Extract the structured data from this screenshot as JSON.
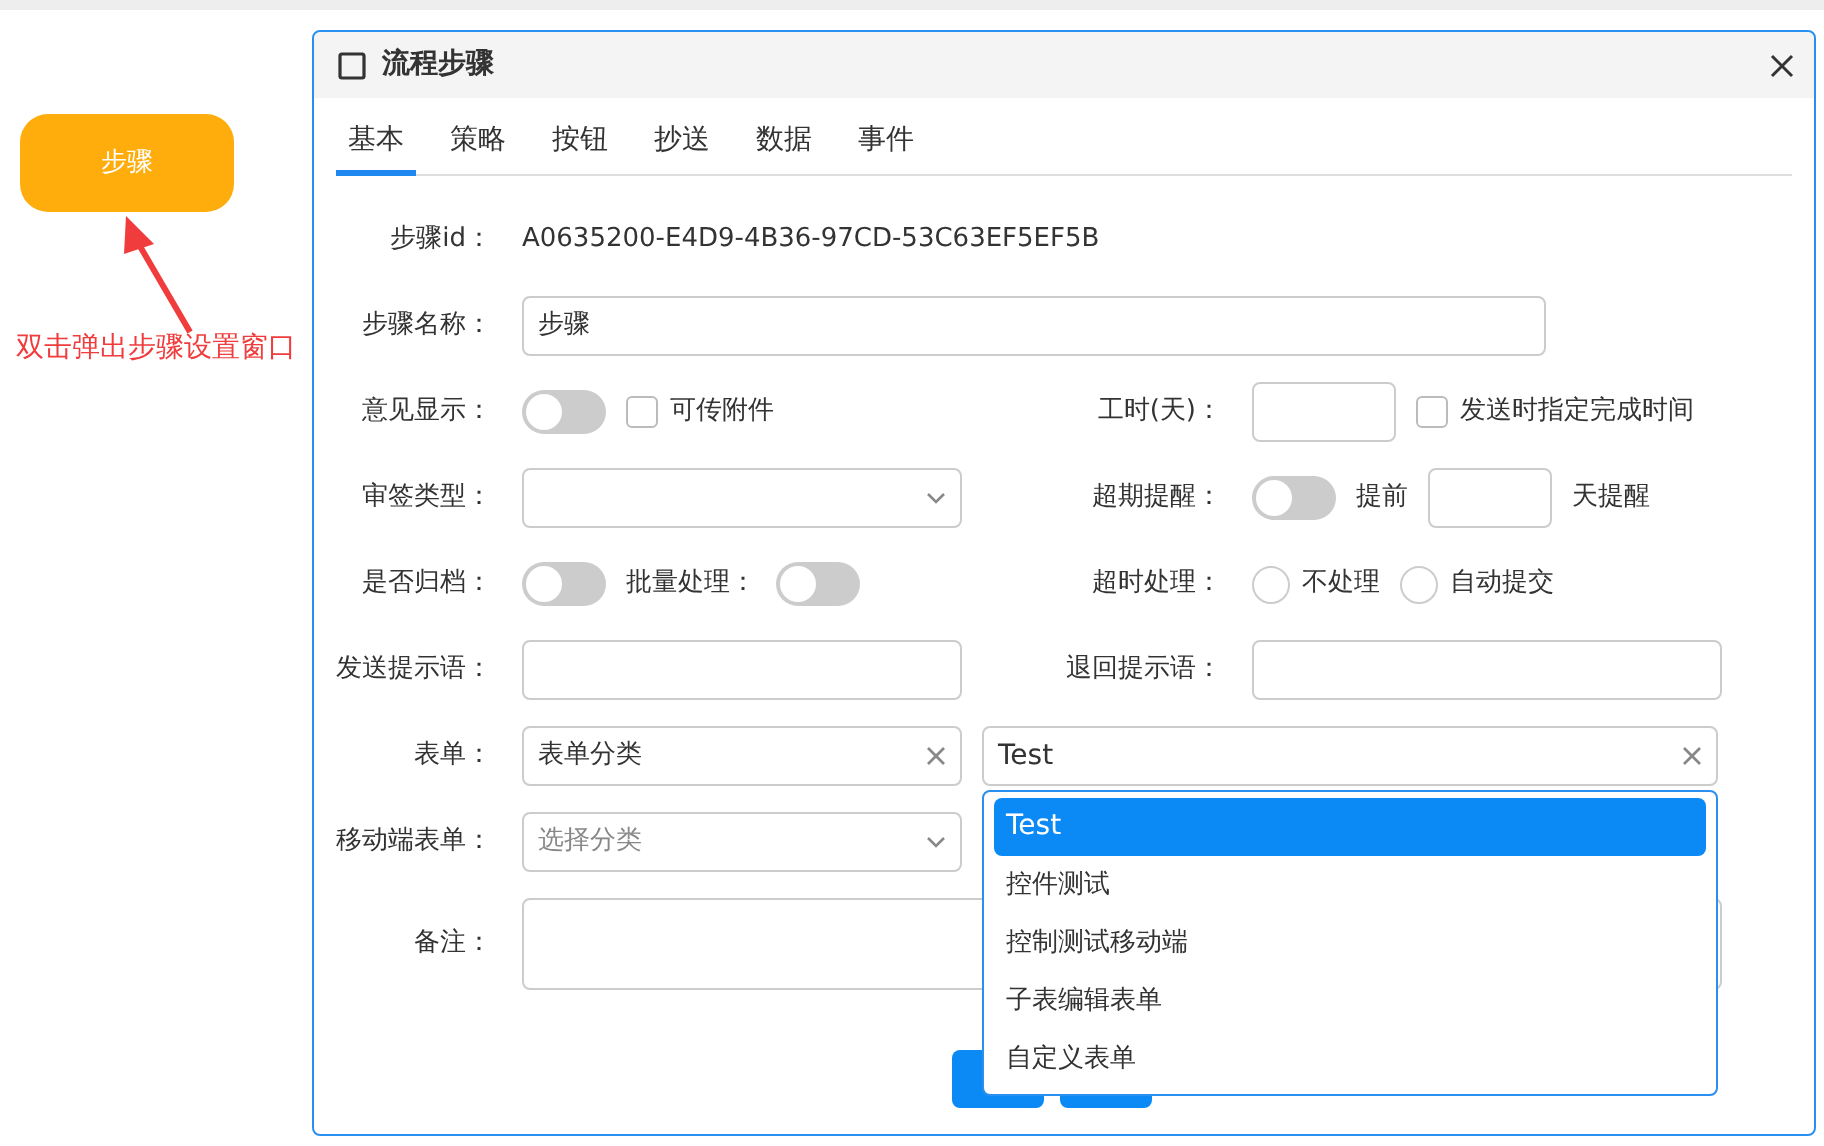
{
  "canvas": {
    "node": {
      "label": "步骤"
    },
    "annotation": "双击弹出步骤设置窗口"
  },
  "dialog": {
    "title": "流程步骤",
    "tabs": [
      {
        "label": "基本",
        "selected": true
      },
      {
        "label": "策略",
        "selected": false
      },
      {
        "label": "按钮",
        "selected": false
      },
      {
        "label": "抄送",
        "selected": false
      },
      {
        "label": "数据",
        "selected": false
      },
      {
        "label": "事件",
        "selected": false
      }
    ],
    "rows": [
      {
        "left": [
          {
            "kind": "label",
            "text": "步骤id："
          },
          {
            "kind": "text",
            "text": "A0635200-E4D9-4B36-97CD-53C63EF5EF5B"
          }
        ]
      },
      {
        "left": [
          {
            "kind": "label",
            "text": "步骤名称："
          },
          {
            "kind": "wideinput",
            "value": "步骤"
          }
        ]
      },
      {
        "left": [
          {
            "kind": "label",
            "text": "意见显示："
          },
          {
            "kind": "toggle",
            "on": false
          },
          {
            "kind": "checkbox",
            "text": "可传附件",
            "checked": false
          }
        ],
        "right": [
          {
            "kind": "label",
            "text": "工时(天)："
          },
          {
            "kind": "smallinput"
          },
          {
            "kind": "checkbox",
            "text": "发送时指定完成时间",
            "checked": false
          }
        ]
      },
      {
        "left": [
          {
            "kind": "label",
            "text": "审签类型："
          },
          {
            "kind": "select"
          }
        ],
        "right": [
          {
            "kind": "label",
            "text": "超期提醒："
          },
          {
            "kind": "toggle",
            "on": false
          },
          {
            "kind": "text",
            "text": "提前"
          },
          {
            "kind": "tinyinput"
          },
          {
            "kind": "text",
            "text": "天提醒"
          }
        ]
      },
      {
        "left": [
          {
            "kind": "label",
            "text": "是否归档："
          },
          {
            "kind": "toggle",
            "on": false
          },
          {
            "kind": "text",
            "text": "批量处理："
          },
          {
            "kind": "toggle",
            "on": false
          }
        ],
        "right": [
          {
            "kind": "label",
            "text": "超时处理："
          },
          {
            "kind": "radio",
            "text": "不处理",
            "selected": false
          },
          {
            "kind": "radio",
            "text": "自动提交",
            "selected": false
          }
        ]
      },
      {
        "left": [
          {
            "kind": "label",
            "text": "发送提示语："
          },
          {
            "kind": "input"
          }
        ],
        "right": [
          {
            "kind": "label",
            "text": "退回提示语："
          },
          {
            "kind": "input"
          }
        ]
      },
      {
        "left": [
          {
            "kind": "label",
            "text": "表单："
          },
          {
            "kind": "combo",
            "value": "表单分类"
          }
        ],
        "right": [
          {
            "kind": "combo",
            "value": "Test",
            "options": [
              {
                "label": "Test",
                "selected": true
              },
              {
                "label": "控件测试",
                "selected": false
              },
              {
                "label": "控制测试移动端",
                "selected": false
              },
              {
                "label": "子表编辑表单",
                "selected": false
              },
              {
                "label": "自定义表单",
                "selected": false
              }
            ]
          }
        ]
      },
      {
        "left": [
          {
            "kind": "label",
            "text": "移动端表单："
          },
          {
            "kind": "select",
            "placeholder": "选择分类"
          }
        ]
      },
      {
        "left": [
          {
            "kind": "label",
            "text": "备注："
          },
          {
            "kind": "textarea"
          }
        ]
      }
    ]
  }
}
